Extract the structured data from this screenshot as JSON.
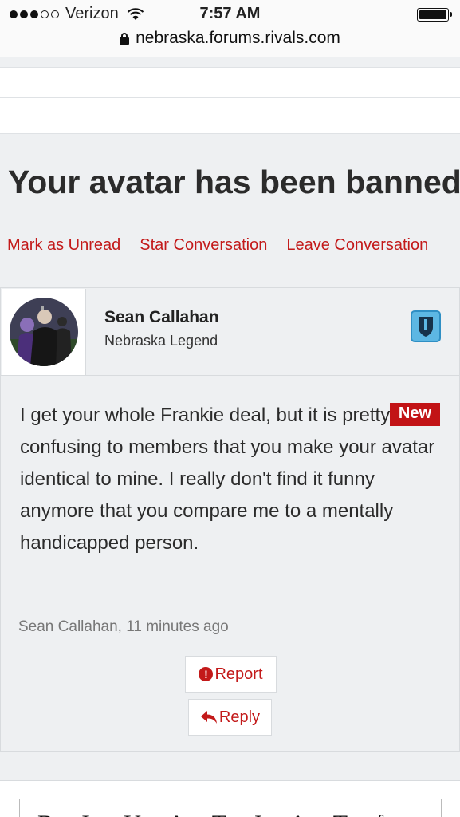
{
  "status_bar": {
    "carrier": "Verizon",
    "time": "7:57 AM",
    "signal_bars": 3,
    "signal_max": 5
  },
  "browser": {
    "url": "nebraska.forums.rivals.com"
  },
  "conversation": {
    "title": "Your avatar has been banned",
    "actions": {
      "mark_unread": "Mark as Unread",
      "star": "Star Conversation",
      "leave": "Leave Conversation"
    }
  },
  "message": {
    "author": "Sean Callahan",
    "rank": "Nebraska Legend",
    "new_label": "New",
    "body": "I get your whole Frankie deal, but it is pretty confusing to members that you make your avatar identical to mine. I really don't find it funny anymore that you compare me to a mentally handicapped person.",
    "meta": "Sean Callahan, 11 minutes ago",
    "report_label": "Report",
    "reply_label": "Reply"
  },
  "footer_ad": {
    "text": "B L U A T I  A  T f"
  },
  "colors": {
    "accent": "#c31a1a",
    "badge_blue": "#3aa0d8",
    "background": "#eef0f2"
  }
}
